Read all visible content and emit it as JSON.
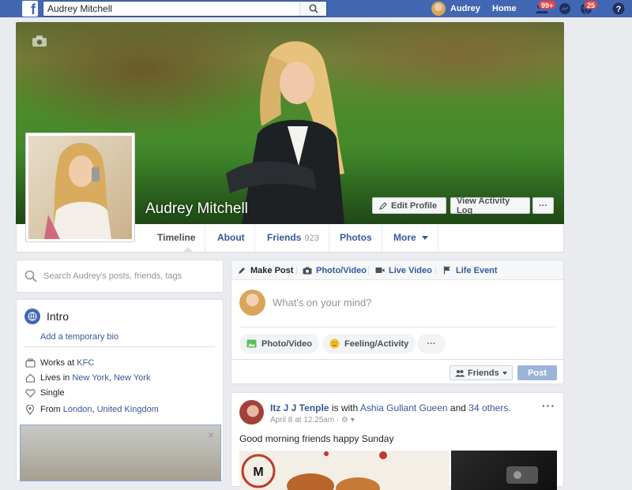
{
  "topbar": {
    "search_value": "Audrey Mitchell",
    "user_name": "Audrey",
    "home_label": "Home",
    "friend_requests_badge": "99+",
    "notifications_badge": "25"
  },
  "profile": {
    "name": "Audrey Mitchell",
    "edit_profile_label": "Edit Profile",
    "activity_log_label": "View Activity Log",
    "more_dots": "···"
  },
  "nav": {
    "tabs": [
      {
        "label": "Timeline"
      },
      {
        "label": "About"
      },
      {
        "label": "Friends",
        "count": "923"
      },
      {
        "label": "Photos"
      },
      {
        "label": "More"
      }
    ]
  },
  "left": {
    "search_placeholder": "Search Audrey's posts, friends, tags",
    "intro_title": "Intro",
    "add_bio": "Add a temporary bio",
    "works_prefix": "Works at",
    "works_value": "KFC",
    "lives_prefix": "Lives in",
    "lives_city": "New York",
    "lives_sep": ",",
    "lives_state": "New York",
    "relationship": "Single",
    "from_prefix": "From",
    "from_city": "London",
    "from_sep": ",",
    "from_country": "United Kingdom"
  },
  "composer": {
    "tabs": [
      "Make Post",
      "Photo/Video",
      "Live Video",
      "Life Event"
    ],
    "placeholder": "What's on your mind?",
    "pill_photo": "Photo/Video",
    "pill_feeling": "Feeling/Activity",
    "pill_more": "···",
    "audience_label": "Friends",
    "post_label": "Post"
  },
  "feed": {
    "author": "Itz J J Tenple",
    "with_text": "is with",
    "tagged": "Ashia Gullant Gueen",
    "and_text": "and",
    "others": "34 others.",
    "meta": "April 8 at 12:25am ·",
    "text": "Good morning friends happy Sunday",
    "more_dots": "···"
  },
  "colors": {
    "brand": "#4267b2",
    "link": "#365899",
    "badge": "#fa3e3e"
  }
}
